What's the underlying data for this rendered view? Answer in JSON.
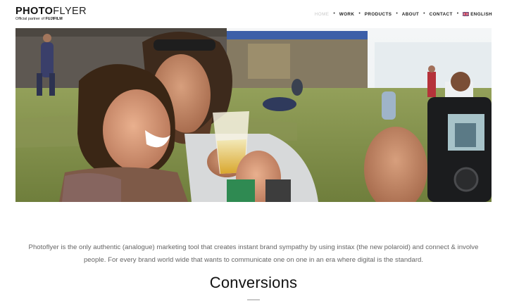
{
  "header": {
    "logo": {
      "brand_bold": "PHOTO",
      "brand_light": "FLYER",
      "tagline_prefix": "Official partner of ",
      "tagline_brand": "FUJIFILM"
    },
    "nav": [
      {
        "label": "HOME",
        "active": true
      },
      {
        "label": "WORK",
        "active": false
      },
      {
        "label": "PRODUCTS",
        "active": false
      },
      {
        "label": "ABOUT",
        "active": false
      },
      {
        "label": "CONTACT",
        "active": false
      },
      {
        "label": "ENGLISH",
        "active": false,
        "icon": "uk-flag-icon"
      }
    ]
  },
  "main": {
    "intro": "Photoflyer is the only authentic (analogue) marketing tool that creates instant brand sympathy by using instax (the new polaroid) and connect & involve people. For every brand world wide that wants to communicate one on one in an era where digital is the standard.",
    "heading": "Conversions"
  },
  "colors": {
    "text": "#111111",
    "muted": "#666666",
    "nav_active": "#c9c9c9",
    "divider": "#c8c8c8"
  }
}
